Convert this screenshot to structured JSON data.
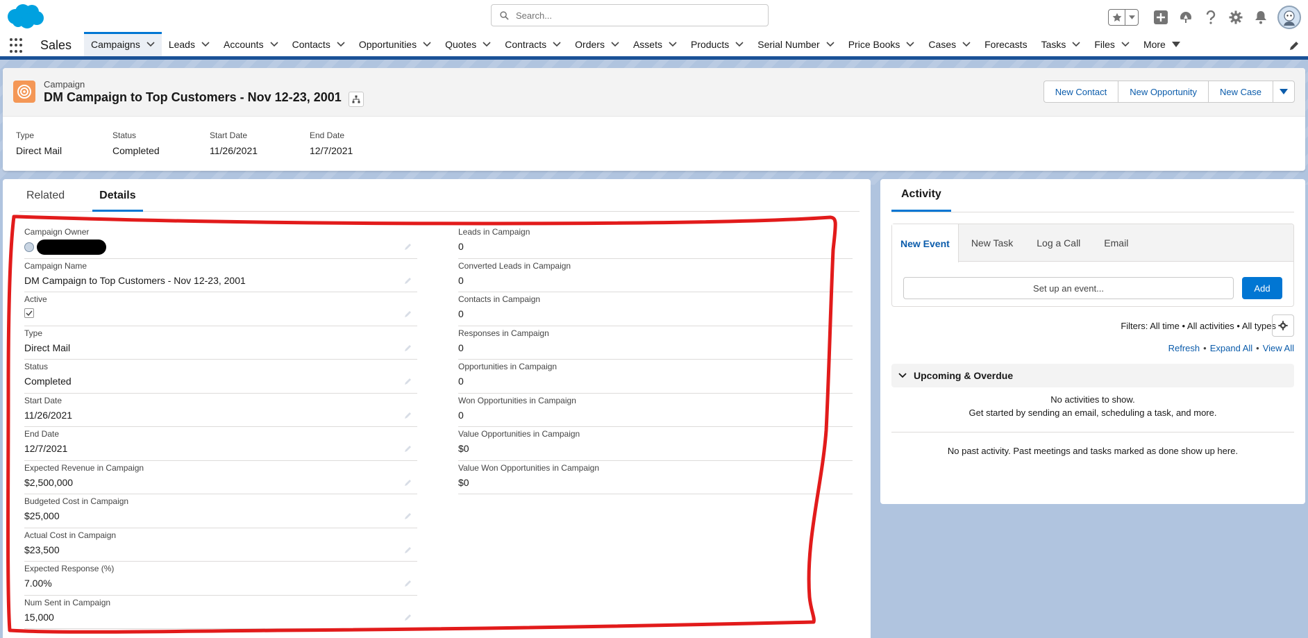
{
  "header": {
    "search_placeholder": "Search...",
    "icons": [
      "favorites-star-icon",
      "add-icon",
      "trailhead-icon",
      "help-icon",
      "setup-gear-icon",
      "bell-icon",
      "avatar"
    ]
  },
  "nav": {
    "app_name": "Sales",
    "items": [
      {
        "label": "Campaigns",
        "chevron": true,
        "active": true
      },
      {
        "label": "Leads",
        "chevron": true
      },
      {
        "label": "Accounts",
        "chevron": true
      },
      {
        "label": "Contacts",
        "chevron": true
      },
      {
        "label": "Opportunities",
        "chevron": true
      },
      {
        "label": "Quotes",
        "chevron": true
      },
      {
        "label": "Contracts",
        "chevron": true
      },
      {
        "label": "Orders",
        "chevron": true
      },
      {
        "label": "Assets",
        "chevron": true
      },
      {
        "label": "Products",
        "chevron": true
      },
      {
        "label": "Serial Number",
        "chevron": true
      },
      {
        "label": "Price Books",
        "chevron": true
      },
      {
        "label": "Cases",
        "chevron": true
      },
      {
        "label": "Forecasts",
        "chevron": false
      },
      {
        "label": "Tasks",
        "chevron": true
      },
      {
        "label": "Files",
        "chevron": true
      },
      {
        "label": "More",
        "chevron": "triangle"
      }
    ]
  },
  "record": {
    "object_type": "Campaign",
    "title": "DM Campaign to Top Customers - Nov 12-23, 2001",
    "actions": [
      "New Contact",
      "New Opportunity",
      "New Case"
    ],
    "highlights": [
      {
        "label": "Type",
        "value": "Direct Mail"
      },
      {
        "label": "Status",
        "value": "Completed"
      },
      {
        "label": "Start Date",
        "value": "11/26/2021"
      },
      {
        "label": "End Date",
        "value": "12/7/2021"
      }
    ]
  },
  "tabs": {
    "related": "Related",
    "details": "Details"
  },
  "details": {
    "left": [
      {
        "label": "Campaign Owner",
        "value": "",
        "kind": "owner"
      },
      {
        "label": "Campaign Name",
        "value": "DM Campaign to Top Customers - Nov 12-23, 2001"
      },
      {
        "label": "Active",
        "value": "",
        "kind": "checkbox",
        "checked": true
      },
      {
        "label": "Type",
        "value": "Direct Mail"
      },
      {
        "label": "Status",
        "value": "Completed"
      },
      {
        "label": "Start Date",
        "value": "11/26/2021"
      },
      {
        "label": "End Date",
        "value": "12/7/2021"
      },
      {
        "label": "Expected Revenue in Campaign",
        "value": "$2,500,000"
      },
      {
        "label": "Budgeted Cost in Campaign",
        "value": "$25,000"
      },
      {
        "label": "Actual Cost in Campaign",
        "value": "$23,500"
      },
      {
        "label": "Expected Response (%)",
        "value": "7.00%"
      },
      {
        "label": "Num Sent in Campaign",
        "value": "15,000"
      }
    ],
    "right": [
      {
        "label": "Leads in Campaign",
        "value": "0"
      },
      {
        "label": "Converted Leads in Campaign",
        "value": "0"
      },
      {
        "label": "Contacts in Campaign",
        "value": "0"
      },
      {
        "label": "Responses in Campaign",
        "value": "0"
      },
      {
        "label": "Opportunities in Campaign",
        "value": "0"
      },
      {
        "label": "Won Opportunities in Campaign",
        "value": "0"
      },
      {
        "label": "Value Opportunities in Campaign",
        "value": "$0"
      },
      {
        "label": "Value Won Opportunities in Campaign",
        "value": "$0"
      }
    ]
  },
  "activity": {
    "tab": "Activity",
    "composer_tabs": [
      "New Event",
      "New Task",
      "Log a Call",
      "Email"
    ],
    "event_placeholder": "Set up an event...",
    "add_label": "Add",
    "filters": "Filters: All time • All activities • All types",
    "links": [
      "Refresh",
      "Expand All",
      "View All"
    ],
    "upcoming_label": "Upcoming & Overdue",
    "no_activities": "No activities to show.",
    "get_started": "Get started by sending an email, scheduling a task, and more.",
    "no_past": "No past activity. Past meetings and tasks marked as done show up here."
  },
  "colors": {
    "brand_blue": "#0176d3",
    "link_blue": "#0b5cab",
    "nav_underline": "#1b5297",
    "campaign_icon": "#f49756",
    "background": "#b0c4df",
    "annotation_red": "#e21b1b"
  }
}
